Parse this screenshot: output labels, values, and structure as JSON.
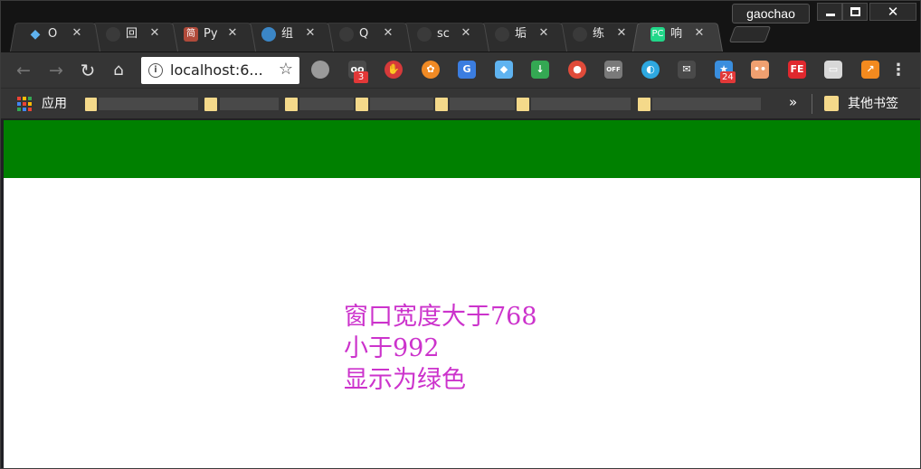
{
  "window": {
    "profile_name": "gaochao",
    "min_glyph": "",
    "max_glyph": "",
    "close_glyph": "✕"
  },
  "tabs": [
    {
      "title": "O",
      "icon": "diamond-icon",
      "color": "#5fb3f0",
      "active": false
    },
    {
      "title": "回",
      "icon": "github-icon",
      "color": "#3a3a3a",
      "active": false
    },
    {
      "title": "Py",
      "icon": "jianshu-icon",
      "color": "#b04a3a",
      "glyph": "简",
      "active": false
    },
    {
      "title": "组",
      "icon": "hexagon-icon",
      "color": "#3b86c6",
      "active": false
    },
    {
      "title": "Q",
      "icon": "github-icon",
      "color": "#3a3a3a",
      "active": false
    },
    {
      "title": "sc",
      "icon": "github-icon",
      "color": "#3a3a3a",
      "active": false
    },
    {
      "title": "垢",
      "icon": "github-icon",
      "color": "#3a3a3a",
      "active": false
    },
    {
      "title": "练",
      "icon": "github-icon",
      "color": "#3a3a3a",
      "active": false
    },
    {
      "title": "响",
      "icon": "pycharm-icon",
      "color": "#21d789",
      "glyph": "PC",
      "active": true
    }
  ],
  "tab_close_glyph": "✕",
  "toolbar": {
    "back_glyph": "←",
    "forward_glyph": "→",
    "reload_glyph": "↻",
    "home_glyph": "⌂",
    "info_glyph": "i",
    "url": "localhost:6...",
    "star_glyph": "☆",
    "menu_glyph": "⋮"
  },
  "extensions": [
    {
      "icon": "cloud-icon",
      "color": "#9a9a9a",
      "glyph": "",
      "badge": ""
    },
    {
      "icon": "oo-icon",
      "color": "#4a4a4a",
      "glyph": "oo",
      "badge": "3"
    },
    {
      "icon": "adblock-hand-icon",
      "color": "#d63a3a",
      "glyph": "✋",
      "badge": ""
    },
    {
      "icon": "pinwheel-icon",
      "color": "#f08a24",
      "glyph": "✿",
      "badge": ""
    },
    {
      "icon": "translate-icon",
      "color": "#3b7de0",
      "glyph": "G",
      "badge": ""
    },
    {
      "icon": "diamond-icon",
      "color": "#5fb3f0",
      "glyph": "◆",
      "badge": ""
    },
    {
      "icon": "download-arrow-icon",
      "color": "#34a853",
      "glyph": "↓",
      "badge": ""
    },
    {
      "icon": "map-pin-icon",
      "color": "#e04b3a",
      "glyph": "●",
      "badge": ""
    },
    {
      "icon": "off-icon",
      "color": "#7a7a7a",
      "glyph": "OFF",
      "badge": ""
    },
    {
      "icon": "globe-icon",
      "color": "#2ea8e0",
      "glyph": "◐",
      "badge": ""
    },
    {
      "icon": "mail-icon",
      "color": "#4a4a4a",
      "glyph": "✉",
      "badge": ""
    },
    {
      "icon": "star-icon",
      "color": "#3a8ede",
      "glyph": "★",
      "badge": "24"
    },
    {
      "icon": "face-icon",
      "color": "#f0a070",
      "glyph": "••",
      "badge": ""
    },
    {
      "icon": "fe-icon",
      "color": "#e0282e",
      "glyph": "FE",
      "badge": ""
    },
    {
      "icon": "window-icon",
      "color": "#d8d8d8",
      "glyph": "▭",
      "badge": ""
    },
    {
      "icon": "trend-chart-icon",
      "color": "#f38a1f",
      "glyph": "↗",
      "badge": ""
    }
  ],
  "bookmarks": {
    "apps_label": "应用",
    "more_glyph": "»",
    "other_label": "其他书签"
  },
  "apps_grid_colors": [
    "#ea4335",
    "#fbbc05",
    "#34a853",
    "#4285f4",
    "#ea4335",
    "#fbbc05",
    "#34a853",
    "#4285f4",
    "#ea4335"
  ],
  "page": {
    "banner_color": "#008000",
    "text_color": "#cc33cc",
    "lines": [
      "窗口宽度大于768",
      "小于992",
      "显示为绿色"
    ]
  }
}
